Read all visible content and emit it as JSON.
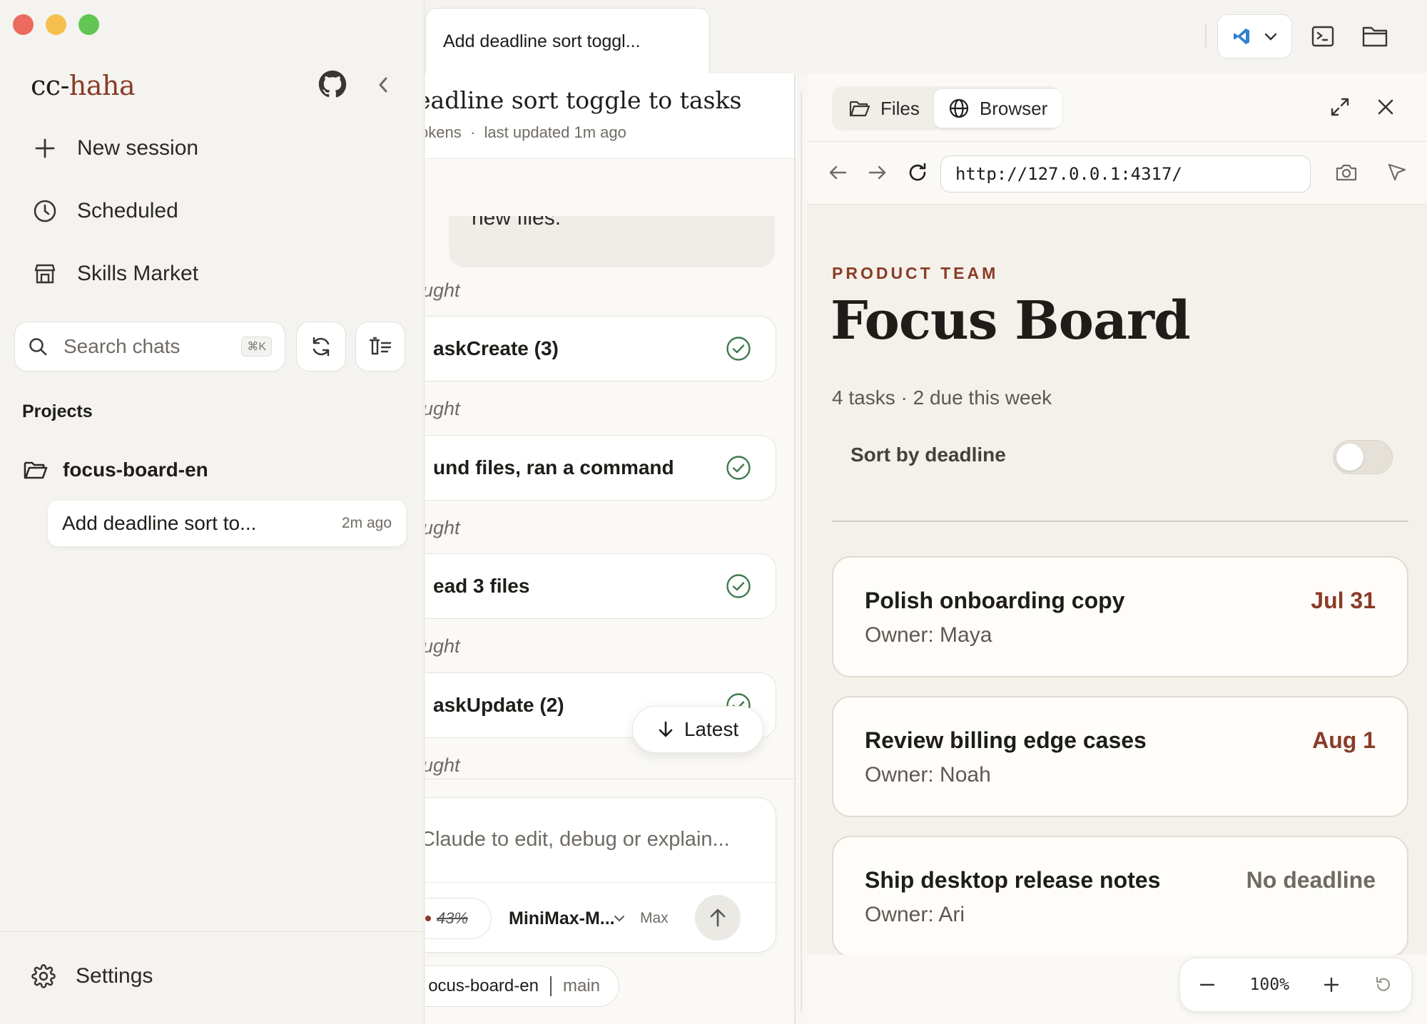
{
  "sidebar": {
    "brand_prefix": "cc-",
    "brand_suffix": "haha",
    "nav": [
      {
        "label": "New session",
        "icon": "plus-icon"
      },
      {
        "label": "Scheduled",
        "icon": "clock-icon"
      },
      {
        "label": "Skills Market",
        "icon": "store-icon"
      }
    ],
    "search_placeholder": "Search chats",
    "search_shortcut": "⌘K",
    "projects_heading": "Projects",
    "project_name": "focus-board-en",
    "session": {
      "title": "Add deadline sort to...",
      "time": "2m ago"
    },
    "settings_label": "Settings"
  },
  "tab": {
    "title": "Add deadline sort toggl..."
  },
  "chat": {
    "title": "eadline sort toggle to tasks",
    "meta_tokens": "okens",
    "meta_sep": "·",
    "meta_updated": "last updated 1m ago",
    "bubble_text": "new files.",
    "thought_label": "ught",
    "tools": [
      {
        "label": "askCreate (3)"
      },
      {
        "label": "und files, ran a command"
      },
      {
        "label": "ead 3 files"
      },
      {
        "label": "askUpdate (2)"
      }
    ],
    "latest_label": "Latest",
    "composer_placeholder": "Claude to edit, debug or explain...",
    "context_pct": "43%",
    "model": "MiniMax-M...",
    "effort": "Max",
    "branch_project": "ocus-board-en",
    "branch_name": "main"
  },
  "panel": {
    "tabs": [
      {
        "label": "Files",
        "icon": "folder-icon"
      },
      {
        "label": "Browser",
        "icon": "globe-icon"
      }
    ],
    "url": "http://127.0.0.1:4317/",
    "zoom": "100%"
  },
  "focus_board": {
    "eyebrow": "PRODUCT TEAM",
    "title": "Focus Board",
    "summary": "4 tasks · 2 due this week",
    "sort_label": "Sort by deadline",
    "sort_on": false,
    "tasks": [
      {
        "title": "Polish onboarding copy",
        "owner": "Owner: Maya",
        "due": "Jul 31"
      },
      {
        "title": "Review billing edge cases",
        "owner": "Owner: Noah",
        "due": "Aug 1"
      },
      {
        "title": "Ship desktop release notes",
        "owner": "Owner: Ari",
        "due": "No deadline"
      }
    ]
  },
  "colors": {
    "accent": "#8a3b27",
    "traffic_red": "#ed6a5e",
    "traffic_yellow": "#f5bf4f",
    "traffic_green": "#62c554",
    "check_green": "#3f7a4d",
    "vscode_blue": "#2f80d1"
  }
}
